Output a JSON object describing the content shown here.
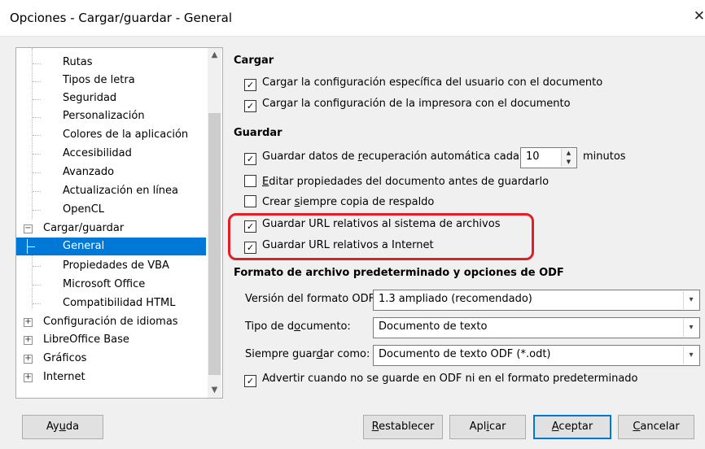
{
  "window": {
    "title": "Opciones - Cargar/guardar - General"
  },
  "tree": {
    "items": [
      {
        "label": "Rutas"
      },
      {
        "label": "Tipos de letra"
      },
      {
        "label": "Seguridad"
      },
      {
        "label": "Personalización"
      },
      {
        "label": "Colores de la aplicación"
      },
      {
        "label": "Accesibilidad"
      },
      {
        "label": "Avanzado"
      },
      {
        "label": "Actualización en línea"
      },
      {
        "label": "OpenCL"
      },
      {
        "label": "Cargar/guardar",
        "expander": "⊟"
      },
      {
        "label": "General",
        "selected": true
      },
      {
        "label": "Propiedades de VBA"
      },
      {
        "label": "Microsoft Office"
      },
      {
        "label": "Compatibilidad HTML"
      },
      {
        "label": "Configuración de idiomas",
        "expander": "⊞"
      },
      {
        "label": "LibreOffice Base",
        "expander": "⊞"
      },
      {
        "label": "Gráficos",
        "expander": "⊞"
      },
      {
        "label": "Internet",
        "expander": "⊞"
      }
    ]
  },
  "cargar": {
    "heading": "Cargar",
    "opt1": "Cargar la configuración específica del usuario con el documento",
    "opt2": "Cargar la configuración de la impresora con el documento"
  },
  "guardar": {
    "heading": "Guardar",
    "autorecover_pre": "Guardar datos de ",
    "autorecover_u": "r",
    "autorecover_post": "ecuperación automática cada:",
    "autorecover_value": "10",
    "autorecover_unit": "minutos",
    "edit_u": "E",
    "edit_post": "ditar propiedades del documento antes de guardarlo",
    "backup_pre": "Crear ",
    "backup_u": "s",
    "backup_post": "iempre copia de respaldo",
    "relfs": "Guardar URL relativos al sistema de archivos",
    "relinet": "Guardar URL relativos a Internet"
  },
  "odf": {
    "heading": "Formato de archivo predeterminado y opciones de ODF",
    "version_label": "Versión del formato ODF:",
    "version_value": "1.3 ampliado (recomendado)",
    "doctype_pre": "Tipo de d",
    "doctype_u": "o",
    "doctype_post": "cumento:",
    "doctype_value": "Documento de texto",
    "saveas_pre": "Siempre guar",
    "saveas_u": "d",
    "saveas_post": "ar como:",
    "saveas_value": "Documento de texto ODF (*.odt)",
    "warn": "Advertir cuando no se guarde en ODF ni en el formato predeterminado"
  },
  "buttons": {
    "help_pre": "Ay",
    "help_u": "u",
    "help_post": "da",
    "reset_u": "R",
    "reset_post": "establecer",
    "apply_pre": "Apl",
    "apply_u": "i",
    "apply_post": "car",
    "ok_u": "A",
    "ok_post": "ceptar",
    "cancel_u": "C",
    "cancel_post": "ancelar"
  },
  "colors": {
    "accent": "#0078d7",
    "highlight": "#e01f26"
  }
}
